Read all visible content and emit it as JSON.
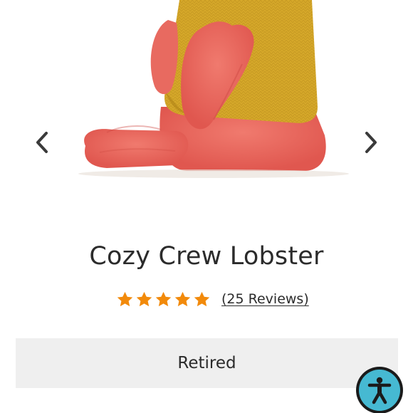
{
  "gallery": {
    "image_alt": "Cozy Crew Lobster plush side view",
    "prev_icon": "chevron-left-icon",
    "next_icon": "chevron-right-icon"
  },
  "product": {
    "title": "Cozy Crew Lobster",
    "rating": 5,
    "rating_max": 5,
    "reviews_label": "(25 Reviews)",
    "status_label": "Retired"
  },
  "colors": {
    "star": "#f28a0b",
    "text": "#2b2b2b",
    "status_bg": "#efefef",
    "a11y_accent": "#46b9d2"
  },
  "accessibility": {
    "icon": "accessibility-person-icon"
  }
}
